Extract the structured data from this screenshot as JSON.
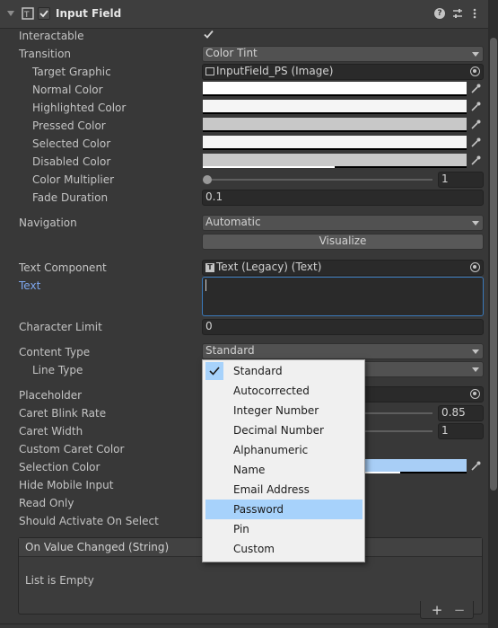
{
  "header": {
    "title": "Input Field",
    "enabled": true,
    "icons": [
      "script-icon",
      "help-icon",
      "preset-icon",
      "more-icon"
    ]
  },
  "props": {
    "interactable": {
      "label": "Interactable",
      "checked": true
    },
    "transition": {
      "label": "Transition",
      "value": "Color Tint"
    },
    "target_graphic": {
      "label": "Target Graphic",
      "value": "InputField_PS (Image)"
    },
    "normal_color": {
      "label": "Normal Color",
      "color": "#ffffff"
    },
    "highlighted_color": {
      "label": "Highlighted Color",
      "color": "#f5f5f5"
    },
    "pressed_color": {
      "label": "Pressed Color",
      "color": "#c8c8c8"
    },
    "selected_color": {
      "label": "Selected Color",
      "color": "#f5f5f5"
    },
    "disabled_color": {
      "label": "Disabled Color",
      "color": "#c8c8c8"
    },
    "color_multiplier": {
      "label": "Color Multiplier",
      "value": "1"
    },
    "fade_duration": {
      "label": "Fade Duration",
      "value": "0.1"
    },
    "navigation": {
      "label": "Navigation",
      "value": "Automatic"
    },
    "visualize": {
      "label": "Visualize"
    },
    "text_component": {
      "label": "Text Component",
      "value": "Text (Legacy) (Text)"
    },
    "text": {
      "label": "Text",
      "value": ""
    },
    "character_limit": {
      "label": "Character Limit",
      "value": "0"
    },
    "content_type": {
      "label": "Content Type",
      "value": "Standard"
    },
    "line_type": {
      "label": "Line Type"
    },
    "placeholder": {
      "label": "Placeholder"
    },
    "caret_blink_rate": {
      "label": "Caret Blink Rate",
      "value": "0.85"
    },
    "caret_width": {
      "label": "Caret Width",
      "value": "1"
    },
    "custom_caret_color": {
      "label": "Custom Caret Color"
    },
    "selection_color": {
      "label": "Selection Color",
      "color": "#a8cef6"
    },
    "hide_mobile_input": {
      "label": "Hide Mobile Input"
    },
    "read_only": {
      "label": "Read Only"
    },
    "should_activate": {
      "label": "Should Activate On Select"
    }
  },
  "content_type_menu": {
    "items": [
      "Standard",
      "Autocorrected",
      "Integer Number",
      "Decimal Number",
      "Alphanumeric",
      "Name",
      "Email Address",
      "Password",
      "Pin",
      "Custom"
    ],
    "checked": "Standard",
    "highlighted": "Password"
  },
  "event": {
    "title": "On Value Changed (String)",
    "empty_text": "List is Empty"
  },
  "list_buttons": {
    "add": "+",
    "remove": "−"
  }
}
